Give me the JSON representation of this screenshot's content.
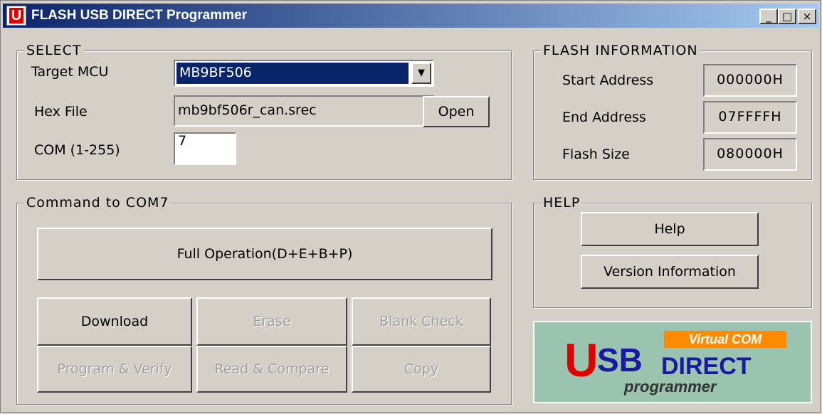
{
  "window": {
    "title": "FLASH USB DIRECT Programmer",
    "icon_letter": "U",
    "controls": {
      "minimize": "_",
      "maximize": "□",
      "close": "×"
    }
  },
  "select": {
    "legend": "SELECT",
    "target_mcu_label": "Target MCU",
    "target_mcu_value": "MB9BF506",
    "hex_file_label": "Hex File",
    "hex_file_value": "mb9bf506r_can.srec",
    "open_label": "Open",
    "com_label": "COM (1-255)",
    "com_value": "7"
  },
  "flash_info": {
    "legend": "FLASH INFORMATION",
    "rows": [
      {
        "label": "Start Address",
        "value": "000000H"
      },
      {
        "label": "End Address",
        "value": "07FFFFH"
      },
      {
        "label": "Flash Size",
        "value": "080000H"
      }
    ]
  },
  "command": {
    "legend": "Command to COM7",
    "full_operation": "Full Operation(D+E+B+P)",
    "download": "Download",
    "erase": "Erase",
    "blank_check": "Blank Check",
    "program_verify": "Program & Verify",
    "read_compare": "Read & Compare",
    "copy": "Copy"
  },
  "help": {
    "legend": "HELP",
    "help_label": "Help",
    "version_label": "Version Information"
  },
  "logo": {
    "tag": "Virtual COM",
    "big_letter": "U",
    "sb": "SB",
    "direct": "DIRECT",
    "programmer": "programmer"
  },
  "colors": {
    "title_start": "#0a246a",
    "title_end": "#a6caf0",
    "selection": "#0a246a",
    "logo_bg": "#9ac4b0",
    "logo_tag": "#ff8c00",
    "logo_red": "#e00000",
    "logo_blue": "#1a1aa0"
  }
}
